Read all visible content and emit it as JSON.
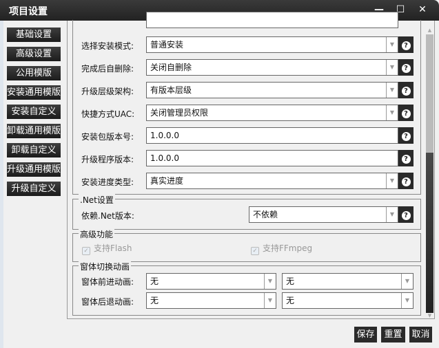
{
  "window": {
    "title": "项目设置",
    "minimize": "—",
    "maximize": "☐",
    "close": "✕"
  },
  "sidebar": {
    "items": [
      {
        "label": "基础设置"
      },
      {
        "label": "高级设置"
      },
      {
        "label": "公用模版"
      },
      {
        "label": "安装通用模版"
      },
      {
        "label": "安装自定义"
      },
      {
        "label": "卸载通用模版"
      },
      {
        "label": "卸载自定义"
      },
      {
        "label": "升级通用模版"
      },
      {
        "label": "升级自定义"
      }
    ]
  },
  "basic": {
    "rows": [
      {
        "label": "选择安装模式:",
        "value": "普通安装",
        "type": "combo"
      },
      {
        "label": "完成后自删除:",
        "value": "关闭自删除",
        "type": "combo"
      },
      {
        "label": "升级层级架构:",
        "value": "有版本层级",
        "type": "combo"
      },
      {
        "label": "快捷方式UAC:",
        "value": "关闭管理员权限",
        "type": "combo"
      },
      {
        "label": "安装包版本号:",
        "value": "1.0.0.0",
        "type": "text"
      },
      {
        "label": "升级程序版本:",
        "value": "1.0.0.0",
        "type": "text"
      },
      {
        "label": "安装进度类型:",
        "value": "真实进度",
        "type": "combo"
      }
    ]
  },
  "net": {
    "legend": ".Net设置",
    "label": "依赖.Net版本:",
    "value": "不依赖"
  },
  "advanced": {
    "legend": "高级功能",
    "flash": "支持Flash",
    "ffmpeg": "支持FFmpeg"
  },
  "animation": {
    "legend": "窗体切换动画",
    "forward_label": "窗体前进动画:",
    "forward_1": "无",
    "forward_2": "无",
    "back_label": "窗体后退动画:",
    "back_1": "无",
    "back_2": "无"
  },
  "help_glyph": "?",
  "arrow_glyph": "▼",
  "footer": {
    "save": "保存",
    "reset": "重置",
    "cancel": "取消"
  }
}
